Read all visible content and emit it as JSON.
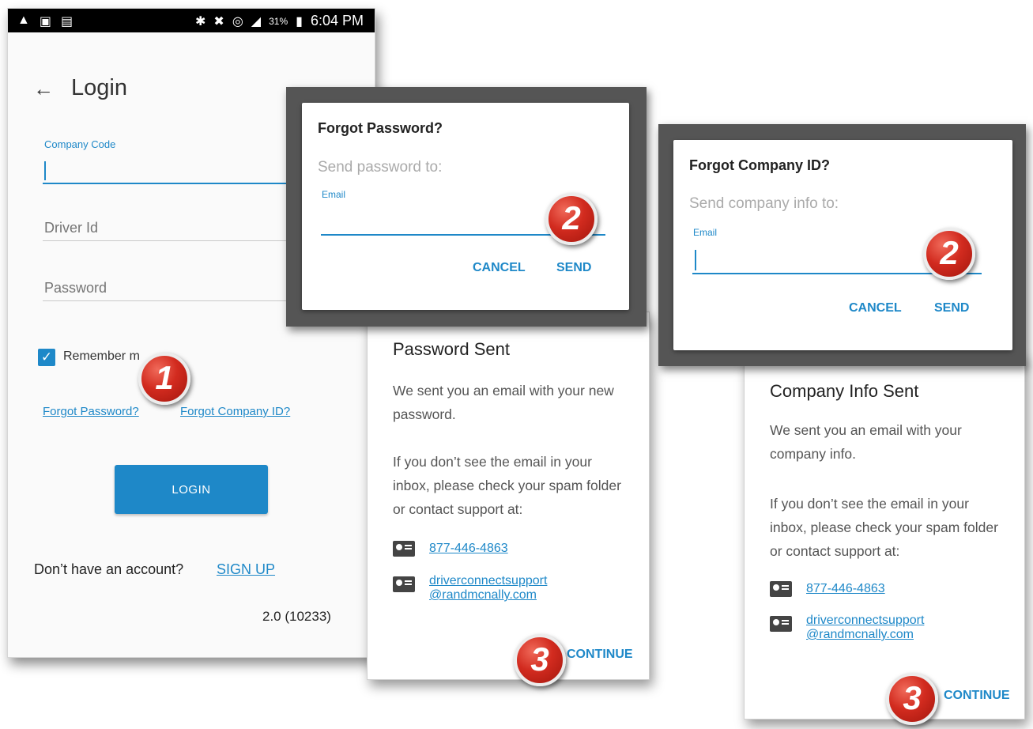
{
  "status_bar": {
    "left_icons": [
      "warning-icon",
      "sim-icon",
      "briefcase-icon"
    ],
    "right_icons": [
      "bluetooth-icon",
      "mute-icon",
      "wifi-icon",
      "signal-icon"
    ],
    "battery": "31%",
    "time": "6:04 PM"
  },
  "login": {
    "title": "Login",
    "company_code_label": "Company Code",
    "driver_id_placeholder": "Driver Id",
    "password_placeholder": "Password",
    "remember_label": "Remember m",
    "forgot_password": "Forgot Password?",
    "forgot_company": "Forgot Company ID?",
    "login_button": "LOGIN",
    "no_account": "Don’t have an account?",
    "sign_up": "SIGN UP",
    "version": "2.0 (10233)"
  },
  "forgot_password_dialog": {
    "title": "Forgot Password?",
    "subtitle": "Send password to:",
    "email_label": "Email",
    "cancel": "CANCEL",
    "send": "SEND"
  },
  "forgot_company_dialog": {
    "title": "Forgot Company ID?",
    "subtitle": "Send company info to:",
    "email_label": "Email",
    "cancel": "CANCEL",
    "send": "SEND"
  },
  "password_sent": {
    "title": "Password Sent",
    "message": "We sent you an email with your new password.",
    "help": "If you don’t see the email in your inbox, please check your spam folder or contact support at:",
    "phone": "877-446-4863",
    "email_line1": "driverconnectsupport",
    "email_line2": "@randmcnally.com",
    "continue": "CONTINUE"
  },
  "company_sent": {
    "title": "Company Info Sent",
    "message": "We sent you an email with your company info.",
    "help": "If you don’t see the email in your inbox, please check your spam folder or contact support at:",
    "phone": "877-446-4863",
    "email_line1": "driverconnectsupport",
    "email_line2": "@randmcnally.com",
    "continue": "CONTINUE"
  },
  "badges": {
    "step1": "1",
    "step2": "2",
    "step3": "3"
  },
  "colors": {
    "accent": "#1e88c8",
    "badge": "#d22b1f"
  }
}
